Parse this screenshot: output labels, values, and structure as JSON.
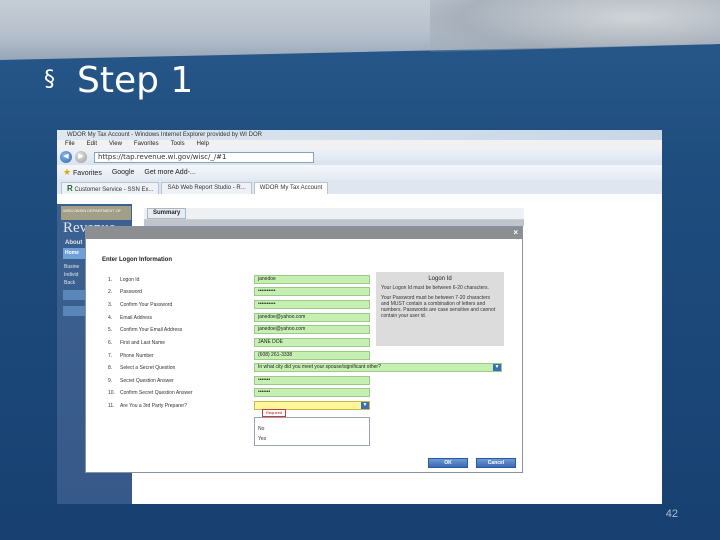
{
  "slide": {
    "title": "Step 1",
    "bullet": "§",
    "page_number": "42"
  },
  "browser": {
    "window_title": "WDOR My Tax Account - Windows Internet Explorer provided by WI DOR",
    "menu": [
      "File",
      "Edit",
      "View",
      "Favorites",
      "Tools",
      "Help"
    ],
    "url": "https://tap.revenue.wi.gov/wisc/_/#1",
    "favorites_label": "Favorites",
    "favorites_links": [
      "Google",
      "Get more Add-..."
    ],
    "tabs": [
      {
        "label": "Customer Service - SSN Ex...",
        "active": false
      },
      {
        "label": "SAb Web Report Studio - R...",
        "active": false
      },
      {
        "label": "WDOR My Tax Account",
        "active": true
      }
    ]
  },
  "sidebar": {
    "logo_top": "WISCONSIN DEPARTMENT OF",
    "logo": "Revenue",
    "about": "About",
    "home": "Home",
    "items": [
      "Busine",
      "Individ",
      "Back"
    ]
  },
  "summary_tab": "Summary",
  "dialog": {
    "title": "Enter Logon Information",
    "rows": [
      {
        "num": "1.",
        "label": "Logon Id",
        "value": "janedoe"
      },
      {
        "num": "2.",
        "label": "Password",
        "value": "••••••••••"
      },
      {
        "num": "3.",
        "label": "Confirm Your Password",
        "value": "••••••••••"
      },
      {
        "num": "4.",
        "label": "Email Address",
        "value": "janedoe@yahoo.com"
      },
      {
        "num": "5.",
        "label": "Confirm Your Email Address",
        "value": "janedoe@yahoo.com"
      },
      {
        "num": "6.",
        "label": "First and Last Name",
        "value": "JANE DOE"
      },
      {
        "num": "7.",
        "label": "Phone Number",
        "value": "(608) 261-3338"
      },
      {
        "num": "8.",
        "label": "Select a Secret Question",
        "value": "In what city did you meet your spouse/significant other?"
      },
      {
        "num": "9.",
        "label": "Secret Question Answer",
        "value": "•••••••"
      },
      {
        "num": "10.",
        "label": "Confirm Secret Question Answer",
        "value": "•••••••"
      },
      {
        "num": "11.",
        "label": "Are You a 3rd Party Preparer?",
        "value": ""
      }
    ],
    "required_tip": "Required",
    "dropdown_options": [
      "No",
      "Yes"
    ],
    "help": {
      "title": "Logon Id",
      "text1": "Your Logon Id must be between 6-20 characters.",
      "text2": "Your Password must be between 7-20 characters and MUST contain a combination of letters and numbers. Passwords are case sensitive and cannot contain your user id."
    },
    "ok_label": "OK",
    "cancel_label": "Cancel"
  }
}
